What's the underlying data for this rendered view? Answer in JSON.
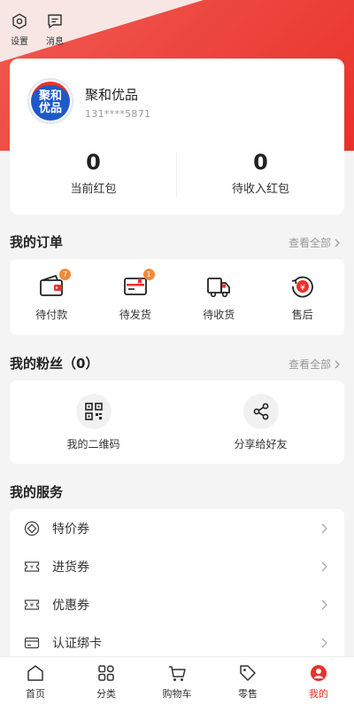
{
  "top_actions": [
    {
      "label": "设置",
      "icon": "settings-icon"
    },
    {
      "label": "消息",
      "icon": "message-icon"
    }
  ],
  "profile": {
    "avatar_text_line1": "聚和",
    "avatar_text_line2": "优品",
    "name": "聚和优品",
    "phone": "131****5871",
    "wallet": [
      {
        "value": "0",
        "label": "当前红包"
      },
      {
        "value": "0",
        "label": "待收入红包"
      }
    ]
  },
  "orders": {
    "title": "我的订单",
    "view_all": "查看全部",
    "items": [
      {
        "label": "待付款",
        "badge": "7",
        "icon": "wallet-icon"
      },
      {
        "label": "待发货",
        "badge": "1",
        "icon": "package-icon"
      },
      {
        "label": "待收货",
        "badge": "",
        "icon": "truck-icon"
      },
      {
        "label": "售后",
        "badge": "",
        "icon": "refund-icon"
      }
    ]
  },
  "fans": {
    "title": "我的粉丝（0）",
    "view_all": "查看全部",
    "items": [
      {
        "label": "我的二维码",
        "icon": "qrcode-icon"
      },
      {
        "label": "分享给好友",
        "icon": "share-icon"
      }
    ]
  },
  "services": {
    "title": "我的服务",
    "items": [
      {
        "label": "特价券",
        "icon": "special-coupon-icon"
      },
      {
        "label": "进货券",
        "icon": "purchase-coupon-icon"
      },
      {
        "label": "优惠券",
        "icon": "discount-coupon-icon"
      },
      {
        "label": "认证绑卡",
        "icon": "bank-card-icon"
      }
    ]
  },
  "tabbar": [
    {
      "label": "首页",
      "icon": "home-icon",
      "active": false
    },
    {
      "label": "分类",
      "icon": "category-icon",
      "active": false
    },
    {
      "label": "购物车",
      "icon": "cart-icon",
      "active": false
    },
    {
      "label": "零售",
      "icon": "tag-icon",
      "active": false
    },
    {
      "label": "我的",
      "icon": "profile-icon",
      "active": true
    }
  ],
  "colors": {
    "accent": "#e8322b",
    "badge": "#f08a3a",
    "avatar_blue": "#1d59c8"
  }
}
